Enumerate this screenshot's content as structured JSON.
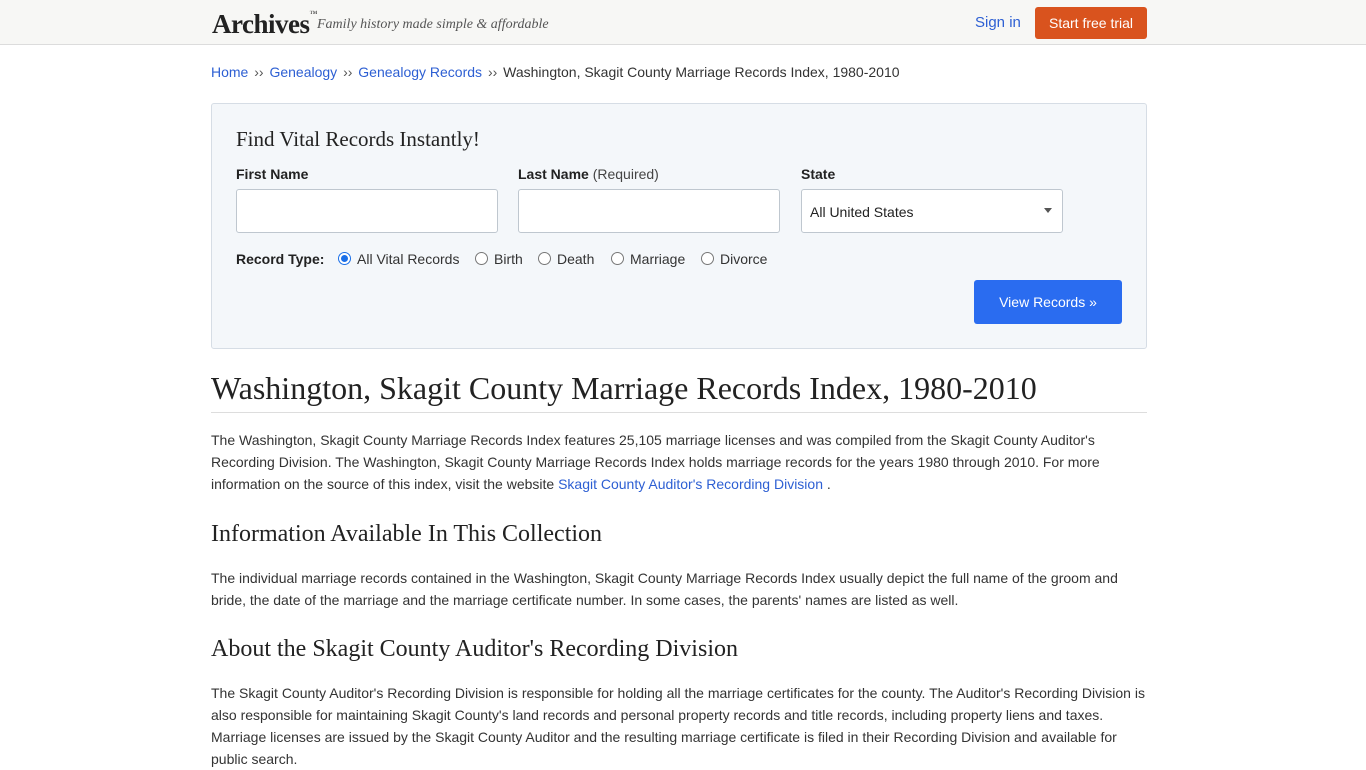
{
  "header": {
    "logo": "Archives",
    "logo_tm": "™",
    "tagline": "Family history made simple & affordable",
    "signin_label": "Sign in",
    "trial_label": "Start free trial"
  },
  "breadcrumb": {
    "items": [
      "Home",
      "Genealogy",
      "Genealogy Records"
    ],
    "separator": "››",
    "current": "Washington, Skagit County Marriage Records Index, 1980-2010"
  },
  "search": {
    "title": "Find Vital Records Instantly!",
    "first_name_label": "First Name",
    "first_name_value": "",
    "last_name_label": "Last Name",
    "last_name_required": "(Required)",
    "last_name_value": "",
    "state_label": "State",
    "state_value": "All United States",
    "record_type_label": "Record Type:",
    "record_types": [
      "All Vital Records",
      "Birth",
      "Death",
      "Marriage",
      "Divorce"
    ],
    "record_type_selected": "All Vital Records",
    "submit_label": "View Records »"
  },
  "main": {
    "title": "Washington, Skagit County Marriage Records Index, 1980-2010",
    "intro": "The Washington, Skagit County Marriage Records Index features 25,105 marriage licenses and was compiled from the Skagit County Auditor's Recording Division. The Washington, Skagit County Marriage Records Index holds marriage records for the years 1980 through 2010. For more information on the source of this index, visit the website ",
    "intro_link": "Skagit County Auditor's Recording Division",
    "intro_end": " .",
    "section1_title": "Information Available In This Collection",
    "section1_text": "The individual marriage records contained in the Washington, Skagit County Marriage Records Index usually depict the full name of the groom and bride, the date of the marriage and the marriage certificate number. In some cases, the parents' names are listed as well.",
    "section2_title": "About the Skagit County Auditor's Recording Division",
    "section2_text": "The Skagit County Auditor's Recording Division is responsible for holding all the marriage certificates for the county. The Auditor's Recording Division is also responsible for maintaining Skagit County's land records and personal property records and title records, including property liens and taxes. Marriage licenses are issued by the Skagit County Auditor and the resulting marriage certificate is filed in their Recording Division and available for public search."
  },
  "colors": {
    "accent_orange": "#d9531e",
    "link_blue": "#2d5fd3",
    "button_blue": "#2a6cf0"
  }
}
